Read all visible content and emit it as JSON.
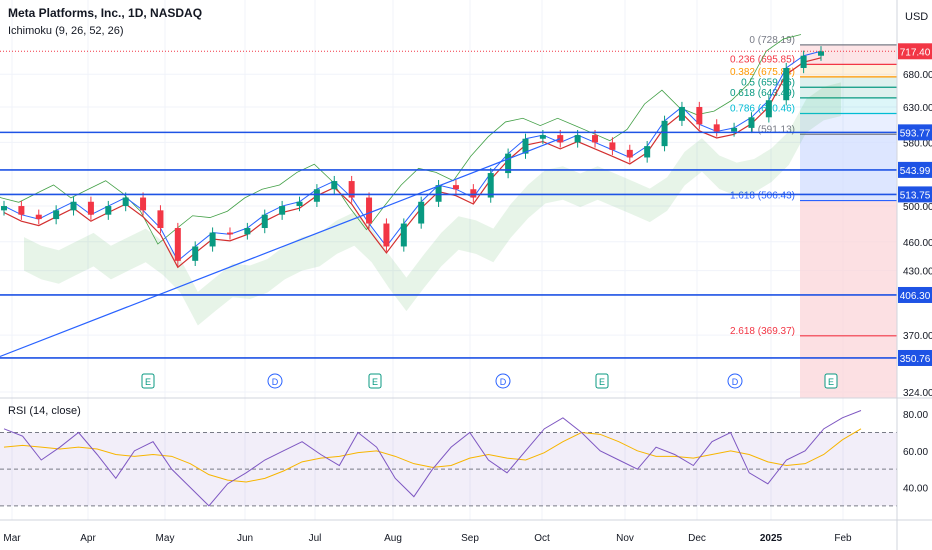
{
  "header": {
    "symbol_title": "Meta Platforms, Inc., 1D, NASDAQ",
    "indicator": "Ichimoku (9, 26, 52, 26)",
    "currency": "USD"
  },
  "chart_data": [
    {
      "type": "candlestick",
      "title": "Meta Platforms, Inc., 1D, NASDAQ",
      "overlay": "Ichimoku (9, 26, 52, 26)",
      "scale": "log",
      "ylim": [
        324,
        740
      ],
      "y_ticks": [
        324,
        370,
        430,
        460,
        500,
        580,
        630,
        680
      ],
      "x_ticks": [
        "Mar",
        "Apr",
        "May",
        "Jun",
        "Jul",
        "Aug",
        "Sep",
        "Oct",
        "Nov",
        "Dec",
        "2025",
        "Feb"
      ],
      "last_price": {
        "value": 717.4,
        "label": "717.40",
        "color": "#f23645"
      },
      "horizontal_levels": [
        {
          "value": 593.77,
          "label": "593.77",
          "color": "#1e53e5"
        },
        {
          "value": 543.99,
          "label": "543.99",
          "color": "#1e53e5"
        },
        {
          "value": 513.75,
          "label": "513.75",
          "color": "#1e53e5"
        },
        {
          "value": 406.3,
          "label": "406.30",
          "color": "#1e53e5"
        },
        {
          "value": 350.76,
          "label": "350.76",
          "color": "#1e53e5"
        }
      ],
      "fibonacci": [
        {
          "ratio": "0",
          "value": 728.19,
          "label": "0 (728.19)",
          "color": "#787b86"
        },
        {
          "ratio": "0.236",
          "value": 695.85,
          "label": "0.236 (695.85)",
          "color": "#f23645"
        },
        {
          "ratio": "0.382",
          "value": 675.84,
          "label": "0.382 (675.84)",
          "color": "#ff9800"
        },
        {
          "ratio": "0.5",
          "value": 659.66,
          "label": "0.5 (659.66)",
          "color": "#089981"
        },
        {
          "ratio": "0.618",
          "value": 643.49,
          "label": "0.618 (643.49)",
          "color": "#089981"
        },
        {
          "ratio": "0.786",
          "value": 620.46,
          "label": "0.786 (620.46)",
          "color": "#00bcd4"
        },
        {
          "ratio": "1",
          "value": 591.13,
          "label": "1 (591.13)",
          "color": "#787b86"
        },
        {
          "ratio": "1.618",
          "value": 506.43,
          "label": "1.618 (506.43)",
          "color": "#2962ff"
        },
        {
          "ratio": "2.618",
          "value": 369.37,
          "label": "2.618 (369.37)",
          "color": "#f23645"
        }
      ],
      "price_series": [
        [
          "Mar",
          500
        ],
        [
          "Mar",
          490
        ],
        [
          "Mar",
          485
        ],
        [
          "Mar",
          495
        ],
        [
          "Mar",
          505
        ],
        [
          "Apr",
          490
        ],
        [
          "Apr",
          500
        ],
        [
          "Apr",
          510
        ],
        [
          "Apr",
          495
        ],
        [
          "Apr",
          475
        ],
        [
          "May",
          440
        ],
        [
          "May",
          455
        ],
        [
          "May",
          470
        ],
        [
          "May",
          468
        ],
        [
          "Jun",
          475
        ],
        [
          "Jun",
          490
        ],
        [
          "Jun",
          500
        ],
        [
          "Jun",
          505
        ],
        [
          "Jul",
          520
        ],
        [
          "Jul",
          530
        ],
        [
          "Jul",
          510
        ],
        [
          "Jul",
          480
        ],
        [
          "Aug",
          455
        ],
        [
          "Aug",
          480
        ],
        [
          "Aug",
          505
        ],
        [
          "Aug",
          525
        ],
        [
          "Sep",
          520
        ],
        [
          "Sep",
          510
        ],
        [
          "Sep",
          540
        ],
        [
          "Sep",
          565
        ],
        [
          "Oct",
          585
        ],
        [
          "Oct",
          590
        ],
        [
          "Oct",
          580
        ],
        [
          "Oct",
          590
        ],
        [
          "Nov",
          580
        ],
        [
          "Nov",
          570
        ],
        [
          "Nov",
          560
        ],
        [
          "Nov",
          575
        ],
        [
          "Dec",
          610
        ],
        [
          "Dec",
          630
        ],
        [
          "Dec",
          605
        ],
        [
          "Dec",
          595
        ],
        [
          "2025",
          600
        ],
        [
          "2025",
          615
        ],
        [
          "2025",
          640
        ],
        [
          "Feb",
          690
        ],
        [
          "Feb",
          710
        ],
        [
          "Feb",
          717.4
        ]
      ],
      "events": {
        "earnings": [
          "Apr",
          "Jul",
          "Oct",
          "2025"
        ],
        "dividends": [
          "May",
          "Aug",
          "Nov"
        ],
        "earnings_marker_label": "E",
        "dividend_marker_label": "D"
      }
    },
    {
      "type": "line",
      "title": "RSI (14, close)",
      "ylim": [
        25,
        85
      ],
      "y_ticks": [
        40.0,
        60.0,
        80.0
      ],
      "y_tick_labels": [
        "40.00",
        "60.00",
        "80.00"
      ],
      "guide_levels": [
        70,
        50,
        30
      ],
      "rsi": [
        72,
        68,
        55,
        62,
        70,
        58,
        45,
        60,
        65,
        50,
        40,
        30,
        42,
        48,
        55,
        60,
        65,
        58,
        52,
        70,
        62,
        45,
        35,
        50,
        62,
        70,
        55,
        48,
        60,
        72,
        78,
        70,
        60,
        55,
        50,
        62,
        58,
        52,
        65,
        70,
        48,
        42,
        55,
        60,
        72,
        78,
        82
      ],
      "rsi_ma": [
        62,
        63,
        62,
        61,
        62,
        61,
        58,
        57,
        58,
        57,
        53,
        47,
        44,
        43,
        45,
        49,
        54,
        56,
        57,
        59,
        60,
        57,
        53,
        51,
        52,
        56,
        58,
        56,
        55,
        59,
        65,
        70,
        69,
        65,
        60,
        57,
        57,
        56,
        58,
        60,
        58,
        54,
        52,
        53,
        58,
        66,
        72
      ]
    }
  ]
}
